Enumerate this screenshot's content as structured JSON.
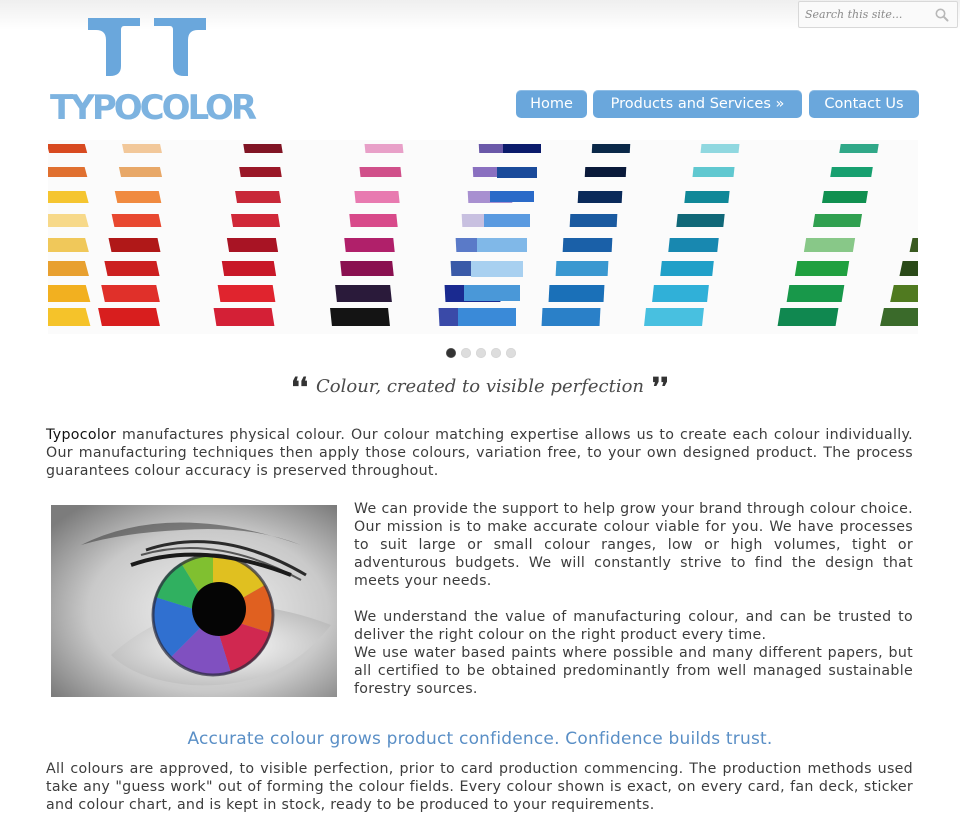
{
  "search": {
    "placeholder": "Search this site..."
  },
  "logo": {
    "text": "TYPOCOLOR"
  },
  "nav": {
    "items": [
      {
        "label": "Home"
      },
      {
        "label": "Products and Services »"
      },
      {
        "label": "Contact Us"
      }
    ]
  },
  "slider": {
    "slide_count": 5,
    "active_slide": 1
  },
  "quote": {
    "text": "Colour, created to visible perfection"
  },
  "intro": {
    "brand": "Typocolor",
    "text": " manufactures physical colour. Our colour matching expertise allows us to create each colour individually. Our manufacturing techniques then apply those colours, variation free, to your own designed product. The process guarantees colour accuracy is preserved throughout."
  },
  "body": {
    "p1": "We can provide the support to help grow your brand through colour choice. Our mission is to make accurate colour viable for you. We have processes to suit large or small colour ranges, low or high volumes, tight or adventurous budgets. We will constantly strive to find the design that meets your needs.",
    "p2": "We understand the value of manufacturing colour, and can be trusted to deliver the right colour on the right product every time.",
    "p3": "We use water based paints where possible and many different papers, but all certified to be obtained predominantly from well managed sustainable forestry sources."
  },
  "tagline": "Accurate colour grows product confidence. Confidence builds trust.",
  "closing": "All colours are approved, to visible perfection, prior to card production commencing. The production methods used take any \"guess work\" out of forming the colour fields. Every colour shown is exact, on every card, fan deck, sticker and colour chart, and is kept in stock, ready to be produced to your requirements.",
  "colors": {
    "accent": "#6aa7dc",
    "logo": "#7db3e0",
    "tagline": "#5a8fc6",
    "swatch_columns": [
      [
        "#f5c32a",
        "#f2b020",
        "#e8a030",
        "#f0c85a",
        "#f7d98a",
        "#f5c530",
        "#e07030",
        "#d84a20"
      ],
      [
        "#d81e1e",
        "#e0302a",
        "#cc2020",
        "#b01818",
        "#e84830",
        "#f08a40",
        "#e8a868",
        "#f2c89a"
      ],
      [
        "#d42036",
        "#e0242e",
        "#c81828",
        "#a81424",
        "#d02838",
        "#c82838",
        "#9a1828",
        "#801424"
      ],
      [
        "#141414",
        "#2a1a3a",
        "#8a1050",
        "#b0206a",
        "#d84a8a",
        "#e87ab0",
        "#d0508a",
        "#e8a0c8"
      ],
      [
        "#3a4aa8",
        "#1a2a90",
        "#3a5aa8",
        "#5a7ac8",
        "#c8c0e0",
        "#a890d0",
        "#8a70c0",
        "#6a58a8"
      ],
      [
        "#3a8ad8",
        "#4a98d8",
        "#a8d0f0",
        "#80b8e8",
        "#5a9ae0",
        "#2a6ac8",
        "#1a4a9a",
        "#0a1a6a"
      ],
      [
        "#2a80c8",
        "#1a70b8",
        "#3a98d0",
        "#1a60a8",
        "#1a5aa0",
        "#0a2a5a",
        "#0a1a3a",
        "#0a2848"
      ],
      [
        "#48c0e0",
        "#30b0d8",
        "#20a0c8",
        "#1888b0",
        "#106878",
        "#108898",
        "#60c8d0",
        "#90d8e0"
      ],
      [
        "#108850",
        "#18984a",
        "#20a040",
        "#88c888",
        "#30a050",
        "#109050",
        "#18a070",
        "#30a888"
      ],
      [
        "#3a6a2a",
        "#507a20",
        "#2a4a18",
        "#3a5a20",
        "#98c070",
        "#80b060",
        "#90c048",
        "#a0c860"
      ],
      [
        "#3a4a20",
        "#8a9a50",
        "#b0a878",
        "#1a1a1a",
        "#a07060",
        "#8a5040",
        "#b08870",
        "#d0b8a0"
      ]
    ]
  }
}
